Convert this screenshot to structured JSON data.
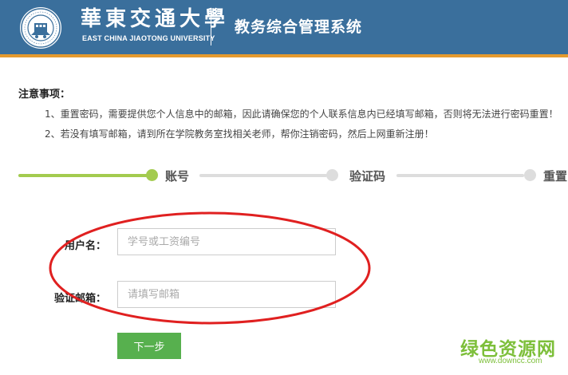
{
  "header": {
    "university_cn": "華東交通大學",
    "university_en": "EAST CHINA JIAOTONG UNIVERSITY",
    "system_title": "教务综合管理系统",
    "logo_icon": "university-seal-icon",
    "background_color": "#3a6f9c",
    "accent_color": "#e49a2e"
  },
  "notice": {
    "title": "注意事项：",
    "items": [
      "1、重置密码，需要提供您个人信息中的邮箱，因此请确保您的个人联系信息内已经填写邮箱，否则将无法进行密码重置！",
      "2、若没有填写邮箱，请到所在学院教务室找相关老师，帮你注销密码，然后上网重新注册！"
    ]
  },
  "steps": {
    "current_index": 0,
    "active_color": "#a3cb4f",
    "inactive_color": "#dddddd",
    "items": [
      {
        "label": "账号"
      },
      {
        "label": "验证码"
      },
      {
        "label": "重置"
      }
    ]
  },
  "form": {
    "username": {
      "label": "用户名：",
      "value": "",
      "placeholder": "学号或工资编号"
    },
    "email": {
      "label": "验证邮箱：",
      "value": "",
      "placeholder": "请填写邮箱"
    },
    "submit_label": "下一步",
    "submit_color": "#57b04e"
  },
  "annotation": {
    "color": "#e02020"
  },
  "watermark": {
    "cn": "绿色资源网",
    "en": "www.downcc.com",
    "color": "#7dbf3a"
  }
}
